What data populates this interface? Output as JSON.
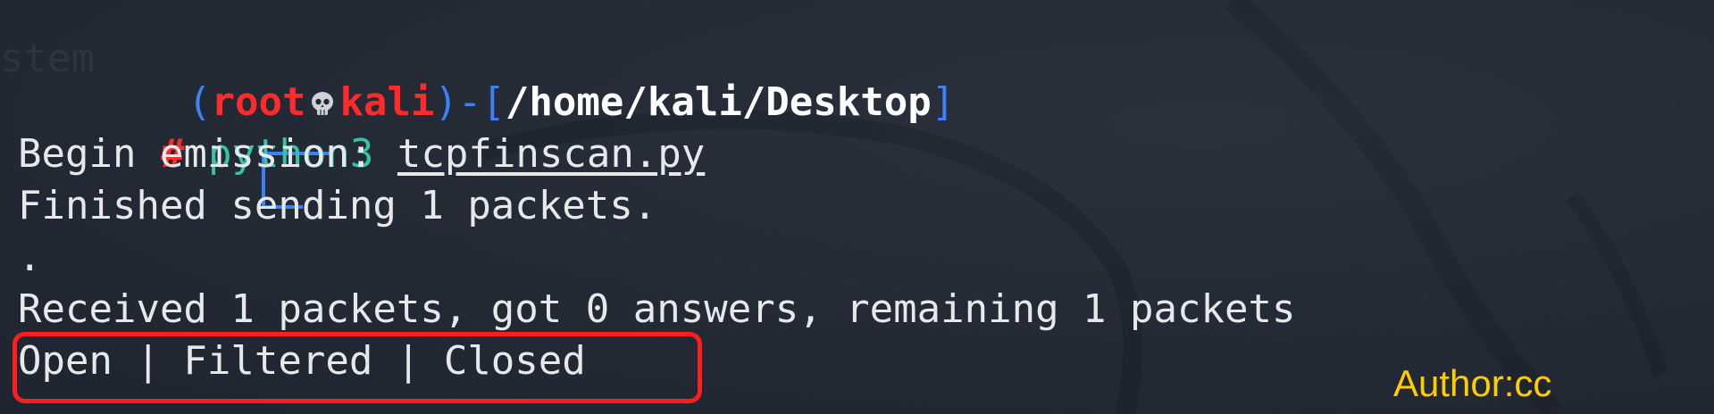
{
  "prompt": {
    "open_paren": "(",
    "user": "root",
    "skull_icon": "skull-icon",
    "host": "kali",
    "close_paren": ")",
    "dash": "-",
    "open_bracket": "[",
    "path": "/home/kali/Desktop",
    "close_bracket": "]",
    "symbol": "#"
  },
  "command": {
    "program": "python3",
    "argument": "tcpfinscan.py"
  },
  "output": [
    "Begin emission:",
    "Finished sending 1 packets.",
    ".",
    "Received 1 packets, got 0 answers, remaining 1 packets",
    "Open | Filtered | Closed"
  ],
  "background_ghost_text": "stem",
  "watermark": "Author:cc",
  "colors": {
    "background": "#222934",
    "prompt_lines": "#3b82f6",
    "user_host": "#ff2a2a",
    "command": "#37c3a6",
    "highlight_box": "#ff1e1e",
    "watermark": "#ffcc00"
  }
}
